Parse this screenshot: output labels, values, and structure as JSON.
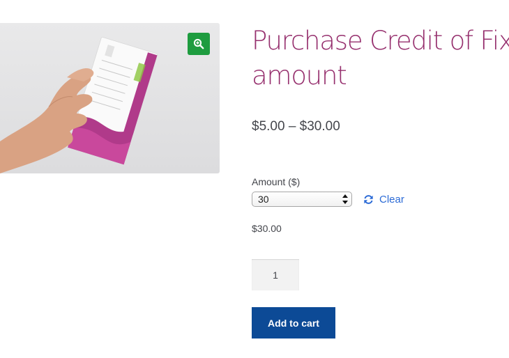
{
  "product": {
    "title": "Purchase Credit of Fixed amount",
    "price_range": "$5.00 – $30.00",
    "image_alt": "Hand holding a gift voucher card"
  },
  "variation": {
    "label": "Amount ($)",
    "selected_value": "30",
    "clear_label": "Clear",
    "price": "$30.00"
  },
  "cart": {
    "quantity": "1",
    "add_to_cart_label": "Add to cart"
  },
  "colors": {
    "title": "#96306e",
    "zoom_button": "#1e9c3f",
    "link": "#2c6bd6",
    "button": "#0c4a96"
  },
  "icons": {
    "zoom": "zoom-in-icon",
    "clear": "refresh-icon",
    "select": "select-arrows-icon"
  }
}
